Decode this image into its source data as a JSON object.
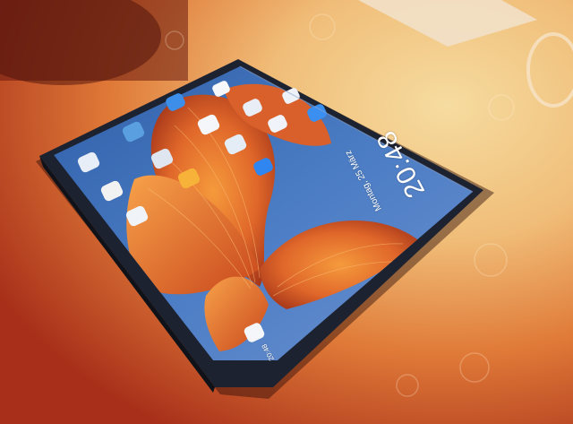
{
  "scene": {
    "description_free": true,
    "colors": {
      "tablecloth_light": "#f3c98a",
      "tablecloth_mid": "#e9924a",
      "tablecloth_red": "#b8361a",
      "device_frame": "#1d2230",
      "screen_blue": "#3f6fb8",
      "wallpaper_orange": "#e8762a",
      "wallpaper_deep": "#b9431a"
    },
    "icons": [
      "app-icon",
      "app-icon",
      "app-icon",
      "app-icon",
      "app-icon",
      "app-icon",
      "app-icon",
      "app-icon",
      "app-icon",
      "app-icon",
      "app-icon",
      "app-icon",
      "app-icon",
      "app-icon",
      "app-icon",
      "app-icon"
    ]
  },
  "lockscreen": {
    "clock": "20:48",
    "date": "Montag, 25 März",
    "status_time": "20:48"
  }
}
